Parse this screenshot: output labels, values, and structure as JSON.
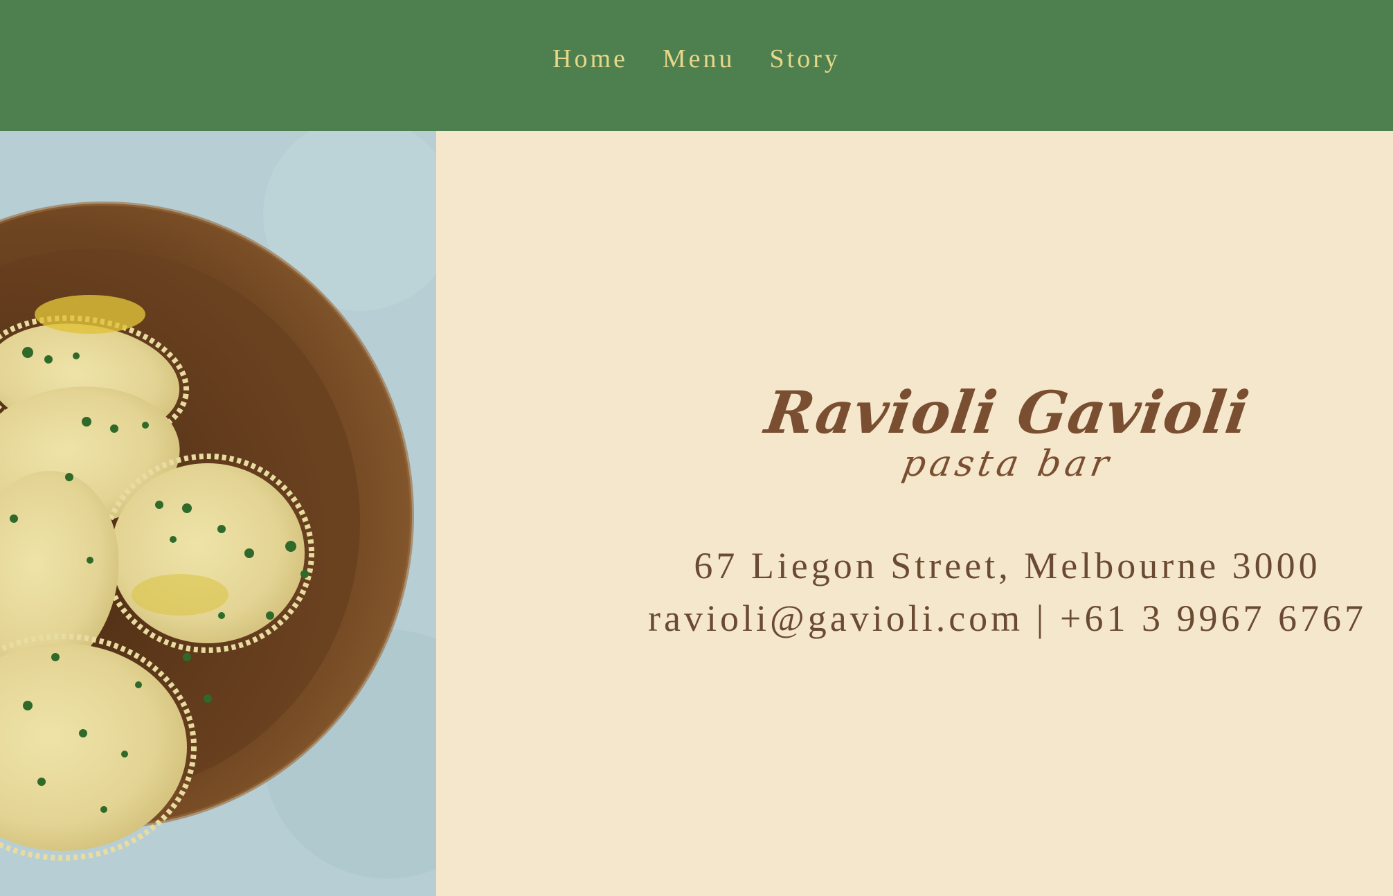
{
  "nav": {
    "items": [
      {
        "label": "Home"
      },
      {
        "label": "Menu"
      },
      {
        "label": "Story"
      }
    ]
  },
  "brand": {
    "title": "Ravioli Gavioli",
    "subtitle": "pasta bar"
  },
  "contact": {
    "address": "67 Liegon Street, Melbourne 3000",
    "email_phone": "ravioli@gavioli.com | +61 3 9967 6767"
  },
  "colors": {
    "header_bg": "#4e7f4e",
    "nav_text": "#e6d889",
    "panel_bg": "#f5e7cc",
    "brand_text": "#7a4e30"
  },
  "hero_image": {
    "subject": "bowl-of-ravioli-icon"
  }
}
